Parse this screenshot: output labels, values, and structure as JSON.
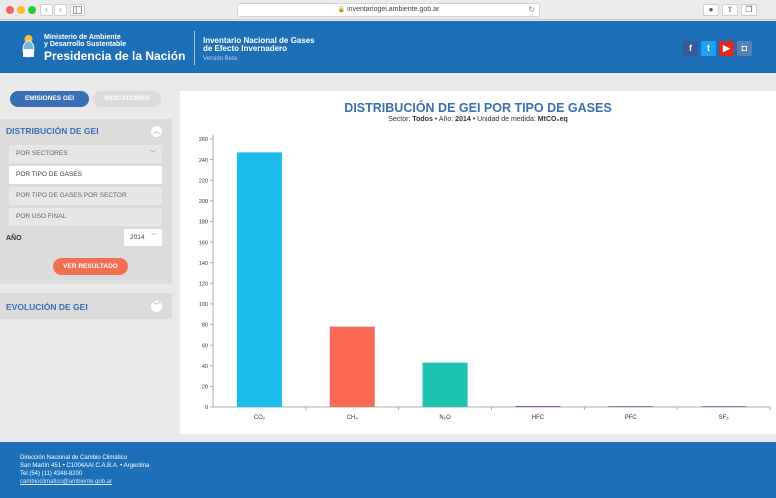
{
  "browser": {
    "url": "inventariogei.ambiente.gob.ar",
    "reload_icon": "reload-icon",
    "nav": {
      "back": "‹",
      "forward": "›"
    }
  },
  "header": {
    "ministry_line1": "Ministerio de Ambiente",
    "ministry_line2": "y Desarrollo Sustentable",
    "presidency": "Presidencia de la Nación",
    "inventory_line1": "Inventario Nacional de Gases",
    "inventory_line2": "de Efecto Invernadero",
    "version": "Versión Beta",
    "social": {
      "facebook": "f",
      "twitter": "t",
      "youtube": "▶",
      "instagram": "◘"
    }
  },
  "sidebar": {
    "tabs": [
      {
        "label": "EMISIONES GEI",
        "active": true
      },
      {
        "label": "INDICADORES",
        "active": false
      }
    ],
    "section1_title": "DISTRIBUCIÓN DE GEI",
    "options": [
      {
        "label": "POR SECTORES",
        "has_chevron": true
      },
      {
        "label": "POR TIPO DE GASES",
        "selected": true
      },
      {
        "label": "POR TIPO DE GASES POR SECTOR"
      },
      {
        "label": "POR USO FINAL"
      }
    ],
    "year_label": "AÑO",
    "year_value": "2014",
    "submit_label": "VER RESULTADO",
    "section2_title": "EVOLUCIÓN DE GEI"
  },
  "chart_data": {
    "type": "bar",
    "title": "DISTRIBUCIÓN DE GEI POR TIPO DE GASES",
    "subtitle": {
      "sector_label": "Sector: ",
      "sector_value": "Todos",
      "sep1": " • Año: ",
      "year_value": "2014",
      "sep2": " • Unidad de medida: ",
      "unit_value": "MtCO₂eq"
    },
    "categories": [
      "CO₂",
      "CH₄",
      "N₂O",
      "HFC",
      "PFC",
      "SF₆"
    ],
    "values": [
      247,
      78,
      43,
      1,
      0.2,
      0.1
    ],
    "colors": [
      "#1bbcec",
      "#fb6a57",
      "#1cc3b1",
      "#8a5a9c",
      "#8a5a9c",
      "#8a5a9c"
    ],
    "ylim": [
      0,
      260
    ],
    "yticks": [
      0,
      20,
      40,
      60,
      80,
      100,
      120,
      140,
      160,
      180,
      200,
      220,
      240,
      260
    ],
    "grid": false
  },
  "footer": {
    "line1": "Dirección Nacional de Cambio Climático",
    "line2": "San Martín 451 • C1004AAI C.A.B.A. • Argentina",
    "line3": "Tel (54) (11) 4348-8200",
    "email": "cambioclimatico@ambiente.gob.ar"
  }
}
